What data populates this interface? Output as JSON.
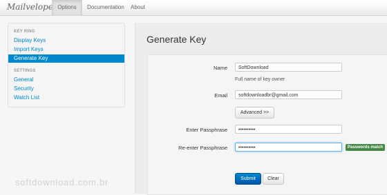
{
  "app": {
    "brand": "Mailvelope"
  },
  "nav": {
    "tabs": [
      "Options",
      "Documentation",
      "About"
    ]
  },
  "sidebar": {
    "sections": [
      {
        "header": "KEY RING",
        "items": [
          "Display Keys",
          "Import Keys",
          "Generate Key"
        ]
      },
      {
        "header": "SETTINGS",
        "items": [
          "General",
          "Security",
          "Watch List"
        ]
      }
    ],
    "active_item": "Generate Key"
  },
  "main": {
    "title": "Generate Key",
    "form": {
      "name_label": "Name",
      "name_value": "SoftDownload",
      "name_help": "Full name of key owner",
      "email_label": "Email",
      "email_value": "softdownloadbr@gmail.com",
      "advanced_button": "Advanced >>",
      "passphrase_label": "Enter Passphrase",
      "passphrase_value": "••••••••••",
      "reenter_label": "Re-enter Passphrase",
      "reenter_value": "••••••••••",
      "match_badge": "Passwords match",
      "submit_button": "Submit",
      "clear_button": "Clear"
    }
  },
  "watermark": "softdownload.com.br",
  "colors": {
    "accent": "#0088cc",
    "success": "#468847"
  }
}
